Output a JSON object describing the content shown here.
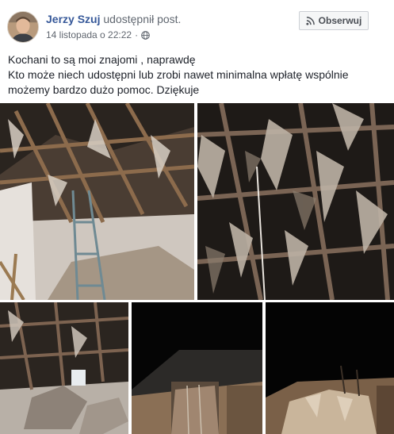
{
  "post": {
    "author": "Jerzy Szuj",
    "action": "udostępnił post.",
    "timestamp": "14 listopada o 22:22",
    "separator": "·",
    "privacy_icon": "globe-icon",
    "follow_button": {
      "label": "Obserwuj",
      "icon": "rss-icon"
    },
    "text_lines": [
      "Kochani to są moi znajomi , naprawdę",
      "Kto może niech udostępni lub zrobi nawet minimalna wpłatę wspólnie",
      "możemy bardzo dużo pomoc. Dziękuje"
    ]
  },
  "colors": {
    "link_blue": "#365899",
    "meta_gray": "#616770",
    "button_bg": "#f5f6f7",
    "button_border": "#ccd0d5"
  }
}
